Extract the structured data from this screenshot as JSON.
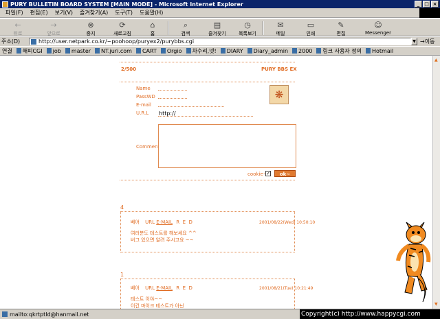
{
  "window": {
    "title": "PURY BULLETIN BOARD SYSTEM [MAIN MODE] - Microsoft Internet Explorer",
    "min": "_",
    "max": "□",
    "close": "×"
  },
  "menu": [
    "파일(F)",
    "편집(E)",
    "보기(V)",
    "즐겨찾기(A)",
    "도구(T)",
    "도움말(H)"
  ],
  "toolbar": {
    "back": "뒤로",
    "forward": "앞으로",
    "stop": "중지",
    "refresh": "새로고침",
    "home": "홈",
    "search": "검색",
    "favorites": "즐겨찾기",
    "history": "목록보기",
    "mail": "메일",
    "print": "인쇄",
    "edit": "편집",
    "messenger": "Messenger"
  },
  "address": {
    "label": "주소(D)",
    "url": "http://user.netpark.co.kr/~poohoop/puryex2/purybbs.cgi",
    "go": "이동"
  },
  "links": {
    "label": "연결",
    "items": [
      "해피CGI",
      "job",
      "master",
      "NT.juri.com",
      "CART",
      "Orgio",
      "차수리,넷!",
      "DIARY",
      "Diary_admin",
      "2000",
      "링크 사용자 정의",
      "Hotmail"
    ]
  },
  "board": {
    "page_info": "2/500",
    "brand": "PURY BBS EX",
    "form": {
      "name_label": "Name",
      "password_label": "PassWD",
      "email_label": "E-mail",
      "url_label": "U.R.L",
      "url_value": "http://",
      "comment_label": "Comment",
      "cookie_label": "cookie~",
      "cookie_checked": "✓",
      "ok_label": "ok~"
    },
    "posts": [
      {
        "number": "4",
        "author": "베어",
        "url_label": "URL",
        "email_label": "E-MAIL",
        "actions": [
          "R",
          "E",
          "D"
        ],
        "date": "2001/08/22(Wed) 10:50:10",
        "lines": [
          "여러분도 테스트를 해보세요 ^^",
          "버그 있으면 알려 주시고요 ~~"
        ]
      },
      {
        "number": "1",
        "author": "베어",
        "url_label": "URL",
        "email_label": "E-MAIL",
        "actions": [
          "R",
          "E",
          "D"
        ],
        "date": "2001/08/21(Tue) 10:21:49",
        "lines": [
          "테스트 이야~~",
          "이건 마이크 테스트가 아닌"
        ]
      }
    ]
  },
  "status": {
    "text": "mailto:qkrtptld@hanmail.net",
    "copyright": "Copyright(c) http://www.happycgi.com"
  },
  "colors": {
    "accent": "#e06a20",
    "chrome": "#d4d0c8",
    "titlebar": "#0a246a"
  }
}
